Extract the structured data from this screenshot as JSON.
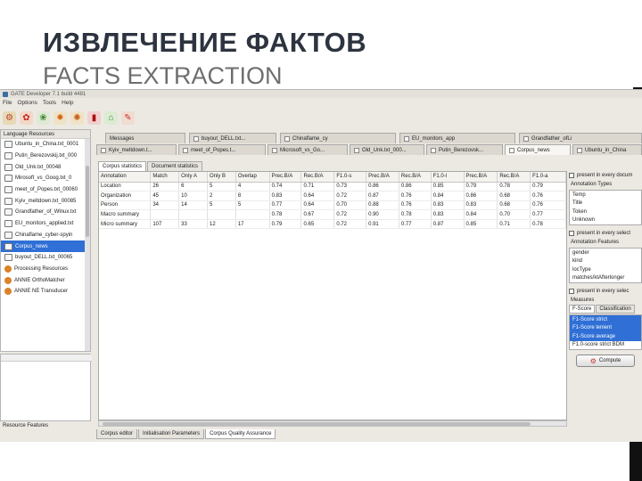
{
  "slide": {
    "title": "ИЗВЛЕЧЕНИЕ ФАКТОВ",
    "subtitle": "FACTS EXTRACTION"
  },
  "app": {
    "title": "GATE Developer 7.1 build 4481",
    "menu": [
      "File",
      "Options",
      "Tools",
      "Help"
    ],
    "toolbar_icons": [
      "load-resource-icon",
      "load-processing-icon",
      "flower-icon",
      "gear-icon",
      "settings-icon",
      "book-icon",
      "home-icon",
      "tools-icon"
    ]
  },
  "tree": {
    "header": "Language Resources",
    "items": [
      {
        "label": "Ubuntu_in_China.txt_0001",
        "selected": false
      },
      {
        "label": "Putin_Berezovskij.txt_000",
        "selected": false
      },
      {
        "label": "Old_Unk.txt_00048",
        "selected": false
      },
      {
        "label": "Mirosoft_vs_Goog.txt_0",
        "selected": false
      },
      {
        "label": "meet_of_Popes.txt_00060",
        "selected": false
      },
      {
        "label": "Kyiv_meltdown.txt_00085",
        "selected": false
      },
      {
        "label": "Grandfather_of_Wlnux.txt",
        "selected": false
      },
      {
        "label": "EU_monitors_applied.txt",
        "selected": false
      },
      {
        "label": "Chinaflame_cyber-spyin",
        "selected": false
      },
      {
        "label": "Corpus_news",
        "selected": true
      },
      {
        "label": "buyout_DELL.txt_00065",
        "selected": false
      },
      {
        "label": "Processing Resources",
        "selected": false
      },
      {
        "label": "ANNIE OrthoMatcher",
        "selected": false
      },
      {
        "label": "ANNIE NE Transducer",
        "selected": false
      }
    ],
    "footer": "Resource Features"
  },
  "doc_tabs": {
    "row1": [
      "Messages",
      "buyout_DELL.txt...",
      "Chinaflame_cy",
      "EU_monitors_app",
      "Grandfather_ofLi"
    ],
    "row2": [
      "Kyiv_meltdown.t...",
      "meet_of_Popes.t...",
      "Microsoft_vs_Go...",
      "Old_Unk.txt_000...",
      "Putin_Berezovsk...",
      "Corpus_news",
      "Ubuntu_in_China"
    ]
  },
  "inner_tabs": [
    "Corpus statistics",
    "Document statistics"
  ],
  "stats_table": {
    "columns": [
      "Annotation",
      "Match",
      "Only A",
      "Only B",
      "Overlap",
      "Prec.B/A",
      "Rec.B/A",
      "F1.0-s",
      "Prec.B/A",
      "Rec.B/A",
      "F1.0-l",
      "Prec.B/A",
      "Rec.B/A",
      "F1.0-a"
    ],
    "rows": [
      [
        "Location",
        "26",
        "6",
        "5",
        "4",
        "0.74",
        "0.71",
        "0.73",
        "0.86",
        "0.86",
        "0.85",
        "0.79",
        "0.78",
        "0.79"
      ],
      [
        "Organization",
        "45",
        "10",
        "2",
        "8",
        "0.83",
        "0.64",
        "0.72",
        "0.87",
        "0.76",
        "0.84",
        "0.86",
        "0.68",
        "0.76"
      ],
      [
        "Person",
        "34",
        "14",
        "5",
        "5",
        "0.77",
        "0.64",
        "0.70",
        "0.88",
        "0.76",
        "0.83",
        "0.83",
        "0.68",
        "0.76"
      ],
      [
        "Macro summary",
        "",
        "",
        "",
        "",
        "0.78",
        "0.67",
        "0.72",
        "0.90",
        "0.78",
        "0.83",
        "0.84",
        "0.70",
        "0.77"
      ],
      [
        "Micro summary",
        "107",
        "33",
        "12",
        "17",
        "0.79",
        "0.65",
        "0.72",
        "0.91",
        "0.77",
        "0.87",
        "0.85",
        "0.71",
        "0.78"
      ]
    ]
  },
  "right_panel": {
    "present_every_doc_1": "present in every docum",
    "annotation_types_label": "Annotation Types",
    "annotation_types": [
      "Temp",
      "Title",
      "Token",
      "Unknown"
    ],
    "present_every_doc_2": "present in every select",
    "annotation_features_label": "Annotation Features",
    "annotation_features": [
      "gender",
      "kind",
      "locType",
      "matches/ktAfterlonger"
    ],
    "present_every_doc_3": "present in every selec",
    "measures_label": "Measures",
    "measures_tabs": [
      "F-Score",
      "Classification"
    ],
    "measures": [
      "F1-Score strict",
      "F1-Score lenient",
      "F1-Score average",
      "F1.0-score strict BDM"
    ],
    "compute_label": "Compute"
  },
  "bottom_tabs": [
    "Corpus editor",
    "Initialisation Parameters",
    "Corpus Quality Assurance"
  ]
}
